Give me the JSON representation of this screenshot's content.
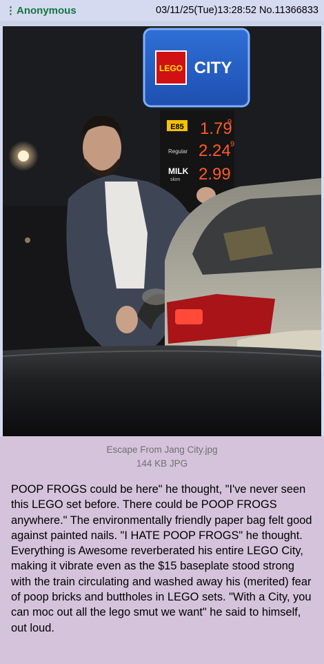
{
  "post": {
    "menu_icon": "⋮",
    "name": "Anonymous",
    "datetime": "03/11/25(Tue)13:28:52",
    "number": "No.11366833"
  },
  "image": {
    "sign_brand_1": "LEGO",
    "sign_brand_2": "CITY",
    "price_label_1": "E85",
    "price_1": "1.79",
    "price_1_sup": "9",
    "price_label_2": "Regular",
    "price_2": "2.24",
    "price_2_sup": "9",
    "price_label_3": "MILK",
    "price_label_3b": "skim",
    "price_3": "2.99"
  },
  "file": {
    "filename": "Escape From Jang City.jpg",
    "filesize": "144 KB JPG"
  },
  "comment": "POOP FROGS could be here\" he thought, \"I've never seen this LEGO set before. There could be POOP FROGS anywhere.\" The environmentally friendly paper bag felt good against painted nails. \"I HATE POOP FROGS\" he thought. Everything is Awesome reverberated his entire LEGO City, making it vibrate even as the $15 baseplate stood strong with the train circulating and washed away his (merited) fear of poop bricks and buttholes in LEGO sets. \"With a City, you can moc out all the lego smut we want\" he said to himself, out loud."
}
